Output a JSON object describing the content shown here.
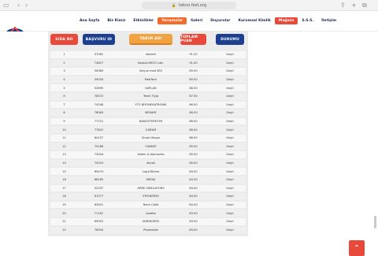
{
  "browser": {
    "url": "tekno fest.org"
  },
  "nav": {
    "items": [
      "Ana Sayfa",
      "Biz Kimiz",
      "Etkinlikler",
      "Yarışmalar",
      "Galeri",
      "Duyurular",
      "Kurumsal Kimlik",
      "Mağaza",
      "S.S.S.",
      "İletişim"
    ]
  },
  "table": {
    "headers": [
      "SIRA NO",
      "BAŞVURU ID",
      "TAKIM ADI",
      "TOPLAM PUAN",
      "DURUMU"
    ],
    "rows": [
      [
        "1",
        "57081",
        "xbezeri",
        "91.20",
        "Geçti"
      ],
      [
        "2",
        "74627",
        "Kapsül-MECO Lab.",
        "91.00",
        "Geçti"
      ],
      [
        "3",
        "56389",
        "Selçuk mad SES",
        "89.50",
        "Geçti"
      ],
      [
        "4",
        "39034",
        "MedTech",
        "89.50",
        "Geçti"
      ],
      [
        "5",
        "52895",
        "KAPLAN",
        "88.50",
        "Geçti"
      ],
      [
        "6",
        "78372",
        "Team Tiyaj",
        "87.50",
        "Geçti"
      ],
      [
        "7",
        "74348",
        "YTÜ BİYOMEKATRONİK",
        "86.50",
        "Geçti"
      ],
      [
        "8",
        "78063",
        "MEKARY",
        "86.50",
        "Geçti"
      ],
      [
        "9",
        "77721",
        "NANOSTEREO59",
        "86.00",
        "Geçti"
      ],
      [
        "10",
        "77647",
        "S-BEAM",
        "86.00",
        "Geçti"
      ],
      [
        "11",
        "64157",
        "Smart Skope",
        "86.00",
        "Geçti"
      ],
      [
        "12",
        "75188",
        "CANKAT",
        "85.00",
        "Geçti"
      ],
      [
        "13",
        "73004",
        "Aliden & Alphanets",
        "85.00",
        "Geçti"
      ],
      [
        "14",
        "70024",
        "devoli",
        "85.00",
        "Geçti"
      ],
      [
        "15",
        "69474",
        "Log10Demo",
        "84.50",
        "Geçti"
      ],
      [
        "16",
        "68185",
        "MEDAI",
        "84.50",
        "Geçti"
      ],
      [
        "17",
        "52337",
        "APME SIMULATORS",
        "84.00",
        "Geçti"
      ],
      [
        "18",
        "61577",
        "EPIONERSS",
        "84.00",
        "Geçti"
      ],
      [
        "19",
        "63501",
        "Team CAVA",
        "84.00",
        "Geçti"
      ],
      [
        "20",
        "71161",
        "AnoBio",
        "83.50",
        "Geçti"
      ],
      [
        "21",
        "69002",
        "AIDENGERS",
        "83.50",
        "Geçti"
      ],
      [
        "22",
        "78334",
        "Phoenates",
        "83.00",
        "Geçti"
      ]
    ]
  }
}
